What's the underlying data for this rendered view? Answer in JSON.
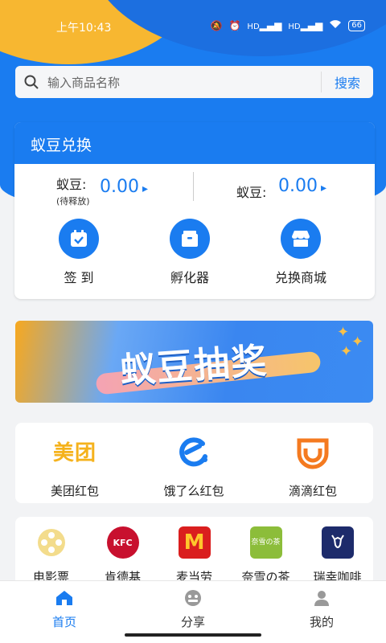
{
  "status_bar": {
    "time": "上午10:43",
    "battery": "66",
    "signal_labels": [
      "HD",
      "HD"
    ]
  },
  "search": {
    "placeholder": "输入商品名称",
    "button": "搜索"
  },
  "exchange_card": {
    "title": "蚁豆兑换",
    "pending_label": "蚁豆:",
    "pending_sub": "(待释放)",
    "pending_value": "0.00",
    "available_label": "蚁豆:",
    "available_value": "0.00",
    "actions": [
      {
        "label": "签  到",
        "icon": "calendar-check-icon"
      },
      {
        "label": "孵化器",
        "icon": "box-icon"
      },
      {
        "label": "兑换商城",
        "icon": "shop-icon"
      }
    ]
  },
  "banner": {
    "title": "蚁豆抽奖"
  },
  "red_packets": [
    {
      "label": "美团红包",
      "logo_text": "美团"
    },
    {
      "label": "饿了么红包"
    },
    {
      "label": "滴滴红包"
    }
  ],
  "brands": [
    {
      "label": "电影票"
    },
    {
      "label": "肯德基",
      "logo_text": "KFC"
    },
    {
      "label": "麦当劳",
      "logo_text": "M"
    },
    {
      "label": "奈雪の茶",
      "logo_text": "奈雪の茶"
    },
    {
      "label": "瑞幸咖啡"
    }
  ],
  "nav": [
    {
      "label": "首页",
      "active": true
    },
    {
      "label": "分享",
      "active": false
    },
    {
      "label": "我的",
      "active": false
    }
  ],
  "colors": {
    "primary": "#1a7cf0",
    "accent_yellow": "#f7b731",
    "background": "#f2f3f5"
  }
}
